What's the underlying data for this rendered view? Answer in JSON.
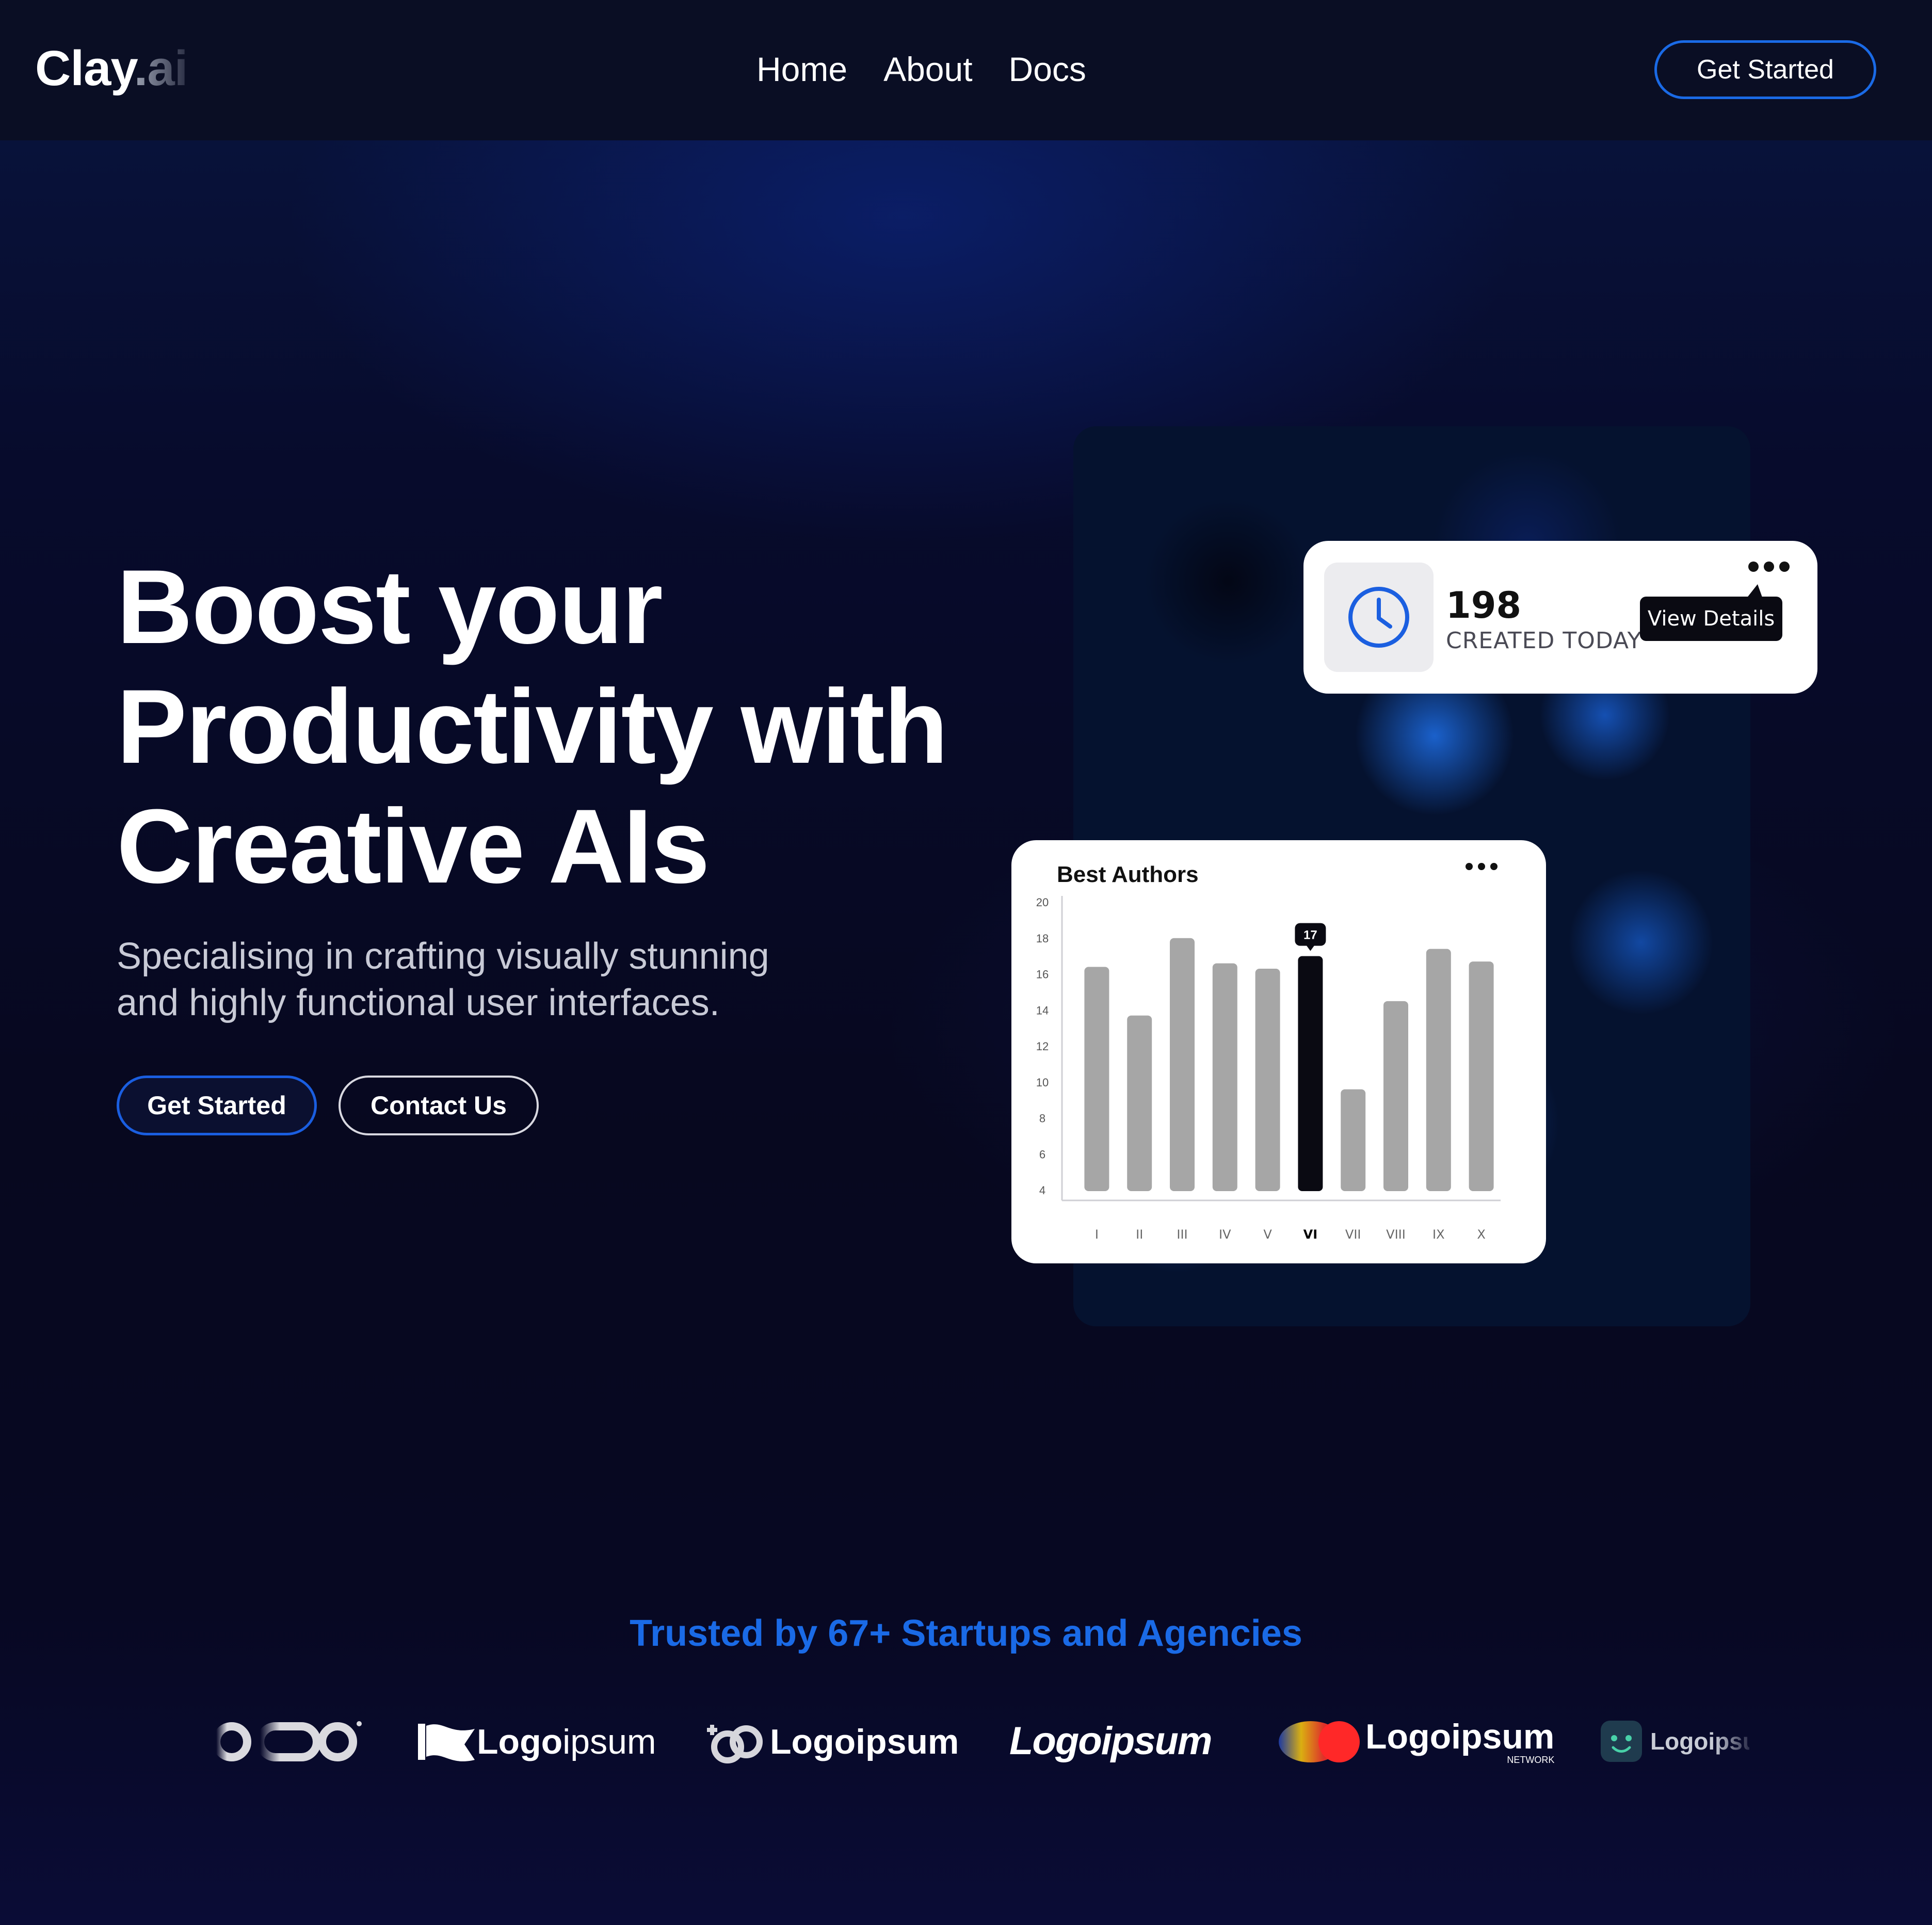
{
  "nav": {
    "brand": "Clay",
    "brand_suffix": ".ai",
    "links": [
      "Home",
      "About",
      "Docs"
    ],
    "cta": "Get Started"
  },
  "hero": {
    "title_lines": [
      "Boost your",
      "Productivity with",
      "Creative AIs"
    ],
    "subtitle_lines": [
      "Specialising in crafting visually stunning",
      "and highly functional user interfaces."
    ],
    "primary_button": "Get Started",
    "secondary_button": "Contact Us"
  },
  "stat_card": {
    "icon": "clock-icon",
    "value": "198",
    "label": "CREATED TODAY",
    "action": "View Details",
    "menu_icon": "more-dots-icon"
  },
  "chart_card": {
    "menu_icon": "more-dots-icon"
  },
  "chart_data": {
    "type": "bar",
    "title": "Best Authors",
    "categories": [
      "I",
      "II",
      "III",
      "IV",
      "V",
      "VI",
      "VII",
      "VIII",
      "IX",
      "X"
    ],
    "values": [
      16.4,
      13.7,
      18.0,
      16.6,
      16.3,
      17,
      9.6,
      14.5,
      17.4,
      16.7
    ],
    "highlight_index": 5,
    "highlight_label": "17",
    "y_ticks": [
      4,
      6,
      8,
      10,
      12,
      14,
      16,
      18,
      20
    ],
    "ylim": [
      4,
      20
    ],
    "bar_color": "#a6a6a6",
    "highlight_color": "#0a0a12",
    "grid": false
  },
  "trusted": {
    "text": "Trusted by 67+ Startups and Agencies",
    "color": "#1a6ae6"
  },
  "logos": [
    {
      "name": "oqo-logo",
      "text": "OQO"
    },
    {
      "name": "logoipsum-flag-logo",
      "text": "Logoipsum",
      "bold": "Logo",
      "light": "ipsum"
    },
    {
      "name": "logoipsum-rings-logo",
      "text": "Logoipsum"
    },
    {
      "name": "logoipsum-italic-logo",
      "text": "Logoipsum"
    },
    {
      "name": "logoipsum-network-logo",
      "text": "Logoipsum",
      "sub": "NETWORK"
    },
    {
      "name": "logoipsum-face-logo",
      "text": "Logoipsu"
    }
  ],
  "colors": {
    "accent": "#1a6ae6",
    "nav_bg": "#0a0e24",
    "page_bg": "#07081c"
  }
}
